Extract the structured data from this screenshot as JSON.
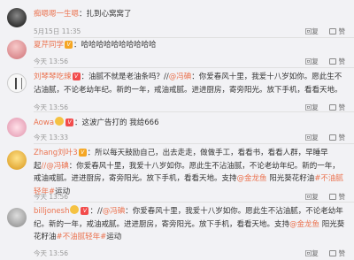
{
  "comments": [
    {
      "username": "痴嗯嗯一生嗯",
      "text": "扎到心窝窝了",
      "time": "5月15日 11:35",
      "actions": {
        "reply": "回复",
        "like": "赞"
      }
    },
    {
      "username": "夏芹同学",
      "text": "哈哈哈哈哈哈哈哈哈哈",
      "time": "今天 13:56",
      "actions": {
        "reply": "回复",
        "like": "赞"
      }
    },
    {
      "username": "刘琴琴吃辣",
      "text_a": "油腻不就是老油条吗？//",
      "mention": "@冯碘",
      "text_b": "你爱春风十里，我爱十八岁如你。愿此生不沾油腻，不论老幼年纪。新的一年，戒油戒腻。进进厨房，寄旁阳光。放下手机，看看天地。",
      "time": "今天 13:56",
      "actions": {
        "reply": "回复",
        "like": "赞"
      }
    },
    {
      "username": "Aowa",
      "text": "这波广告打的 我给666",
      "time": "今天 13:33",
      "actions": {
        "reply": "回复",
        "like": "赞"
      }
    },
    {
      "username": "Zhang刘叶3",
      "text_a": "所以每天鼓励自己，出去走走，做做手工，看看书，看看人群，早睡早起",
      "mention": "//@冯碘",
      "text_b": "你爱春风十里，我爱十八岁如你。愿此生不沾油腻，不论老幼年纪。新的一年，戒油戒腻。进进厨房，寄旁阳光。放下手机，看看天地。支持",
      "mention2": "@金龙鱼",
      "text_c": "阳光葵花籽油",
      "tag": "#不油腻轻年#",
      "text_d": "运动",
      "time": "今天 13:56",
      "actions": {
        "reply": "回复",
        "like": "赞"
      }
    },
    {
      "username": "billjonesh",
      "text_a": "//",
      "mention": "@冯碘",
      "text_b": "你爱春风十里，我爱十八岁如你。愿此生不沾油腻，不论老幼年纪。新的一年，戒油戒腻。进进厨房，寄旁阳光。放下手机，看看天地。支持",
      "mention2": "@金龙鱼",
      "text_c": "阳光葵花籽油",
      "tag": "#不油腻轻年#",
      "text_d": "运动",
      "time": "今天 13:56",
      "actions": {
        "reply": "回复",
        "like": "赞"
      }
    }
  ]
}
